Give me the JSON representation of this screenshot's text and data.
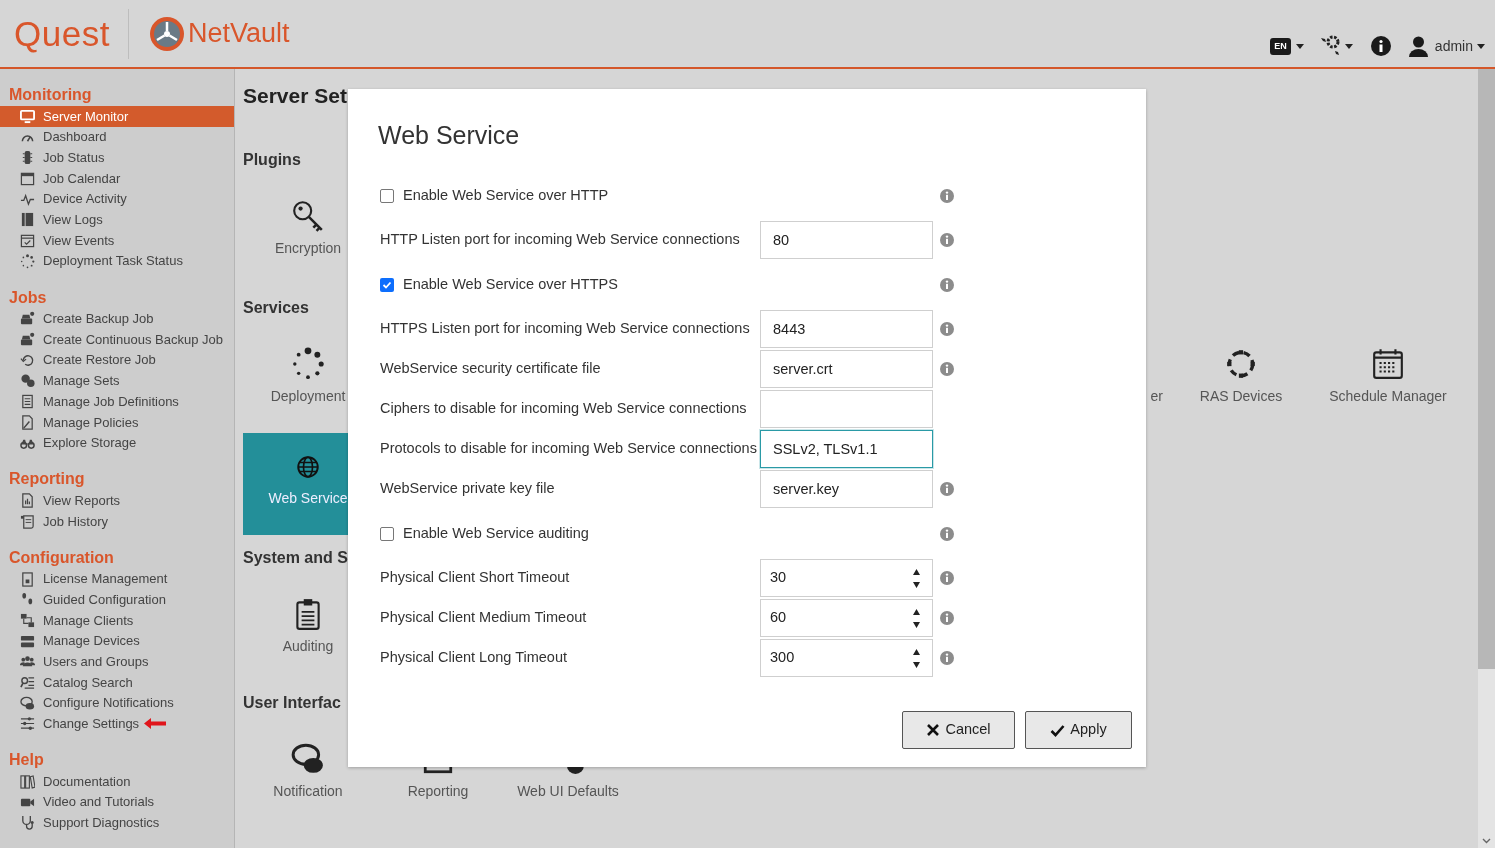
{
  "header": {
    "brand": "Quest",
    "product": "NetVault",
    "language": "EN",
    "user": "admin"
  },
  "sidebar": {
    "sections": [
      {
        "title": "Monitoring",
        "items": [
          {
            "label": "Server Monitor",
            "selected": true,
            "pointer": false
          },
          {
            "label": "Dashboard",
            "selected": false,
            "pointer": false
          },
          {
            "label": "Job Status",
            "selected": false,
            "pointer": false
          },
          {
            "label": "Job Calendar",
            "selected": false,
            "pointer": false
          },
          {
            "label": "Device Activity",
            "selected": false,
            "pointer": false
          },
          {
            "label": "View Logs",
            "selected": false,
            "pointer": false
          },
          {
            "label": "View Events",
            "selected": false,
            "pointer": false
          },
          {
            "label": "Deployment Task Status",
            "selected": false,
            "pointer": false
          }
        ]
      },
      {
        "title": "Jobs",
        "items": [
          {
            "label": "Create Backup Job",
            "selected": false,
            "pointer": false
          },
          {
            "label": "Create Continuous Backup Job",
            "selected": false,
            "pointer": false
          },
          {
            "label": "Create Restore Job",
            "selected": false,
            "pointer": false
          },
          {
            "label": "Manage Sets",
            "selected": false,
            "pointer": false
          },
          {
            "label": "Manage Job Definitions",
            "selected": false,
            "pointer": false
          },
          {
            "label": "Manage Policies",
            "selected": false,
            "pointer": false
          },
          {
            "label": "Explore Storage",
            "selected": false,
            "pointer": false
          }
        ]
      },
      {
        "title": "Reporting",
        "items": [
          {
            "label": "View Reports",
            "selected": false,
            "pointer": false
          },
          {
            "label": "Job History",
            "selected": false,
            "pointer": false
          }
        ]
      },
      {
        "title": "Configuration",
        "items": [
          {
            "label": "License Management",
            "selected": false,
            "pointer": false
          },
          {
            "label": "Guided Configuration",
            "selected": false,
            "pointer": false
          },
          {
            "label": "Manage Clients",
            "selected": false,
            "pointer": false
          },
          {
            "label": "Manage Devices",
            "selected": false,
            "pointer": false
          },
          {
            "label": "Users and Groups",
            "selected": false,
            "pointer": false
          },
          {
            "label": "Catalog Search",
            "selected": false,
            "pointer": false
          },
          {
            "label": "Configure Notifications",
            "selected": false,
            "pointer": false
          },
          {
            "label": "Change Settings",
            "selected": false,
            "pointer": true
          }
        ]
      },
      {
        "title": "Help",
        "items": [
          {
            "label": "Documentation",
            "selected": false,
            "pointer": false
          },
          {
            "label": "Video and Tutorials",
            "selected": false,
            "pointer": false
          },
          {
            "label": "Support Diagnostics",
            "selected": false,
            "pointer": false
          }
        ]
      }
    ]
  },
  "page": {
    "title": "Server Set",
    "sections": [
      {
        "title": "Plugins",
        "rows": [
          [
            {
              "label": "Encryption",
              "selected": false
            }
          ]
        ]
      },
      {
        "title": "Services",
        "rows": [
          [
            {
              "label": "Deployment",
              "selected": false
            },
            {
              "label": "er",
              "selected": false
            },
            {
              "label": "RAS Devices",
              "selected": false
            },
            {
              "label": "Schedule Manager",
              "selected": false
            }
          ],
          [
            {
              "label": "Web Service",
              "selected": true
            }
          ]
        ]
      },
      {
        "title": "System and S",
        "rows": [
          [
            {
              "label": "Auditing",
              "selected": false
            }
          ]
        ]
      },
      {
        "title": "User Interfac",
        "rows": [
          [
            {
              "label": "Notification",
              "selected": false
            },
            {
              "label": "Reporting",
              "selected": false
            },
            {
              "label": "Web UI Defaults",
              "selected": false
            }
          ]
        ]
      }
    ]
  },
  "dialog": {
    "title": "Web Service",
    "fields": [
      {
        "kind": "checkbox",
        "label": "Enable Web Service over HTTP",
        "checked": false,
        "info": true
      },
      {
        "kind": "text",
        "label": "HTTP Listen port for incoming Web Service connections",
        "value": "80",
        "focused": false,
        "info": true
      },
      {
        "kind": "checkbox",
        "label": "Enable Web Service over HTTPS",
        "checked": true,
        "info": true
      },
      {
        "kind": "text",
        "label": "HTTPS Listen port for incoming Web Service connections",
        "value": "8443",
        "focused": false,
        "info": true
      },
      {
        "kind": "text",
        "label": "WebService security certificate file",
        "value": "server.crt",
        "focused": false,
        "info": true
      },
      {
        "kind": "text",
        "label": "Ciphers to disable for incoming Web Service connections",
        "focused": false,
        "info": false
      },
      {
        "kind": "text",
        "label": "Protocols to disable for incoming Web Service connections",
        "value": "SSLv2, TLSv1.1",
        "focused": true,
        "info": false
      },
      {
        "kind": "text",
        "label": "WebService private key file",
        "value": "server.key",
        "focused": false,
        "info": true
      },
      {
        "kind": "checkbox",
        "label": "Enable Web Service auditing",
        "checked": false,
        "info": true
      },
      {
        "kind": "number",
        "label": "Physical Client Short Timeout",
        "value": "30",
        "focused": false,
        "info": true
      },
      {
        "kind": "number",
        "label": "Physical Client Medium Timeout",
        "value": "60",
        "focused": false,
        "info": true
      },
      {
        "kind": "number",
        "label": "Physical Client Long Timeout",
        "value": "300",
        "focused": false,
        "info": true
      }
    ],
    "buttons": [
      {
        "kind": "cancel",
        "label": "Cancel"
      },
      {
        "kind": "apply",
        "label": "Apply"
      }
    ]
  }
}
